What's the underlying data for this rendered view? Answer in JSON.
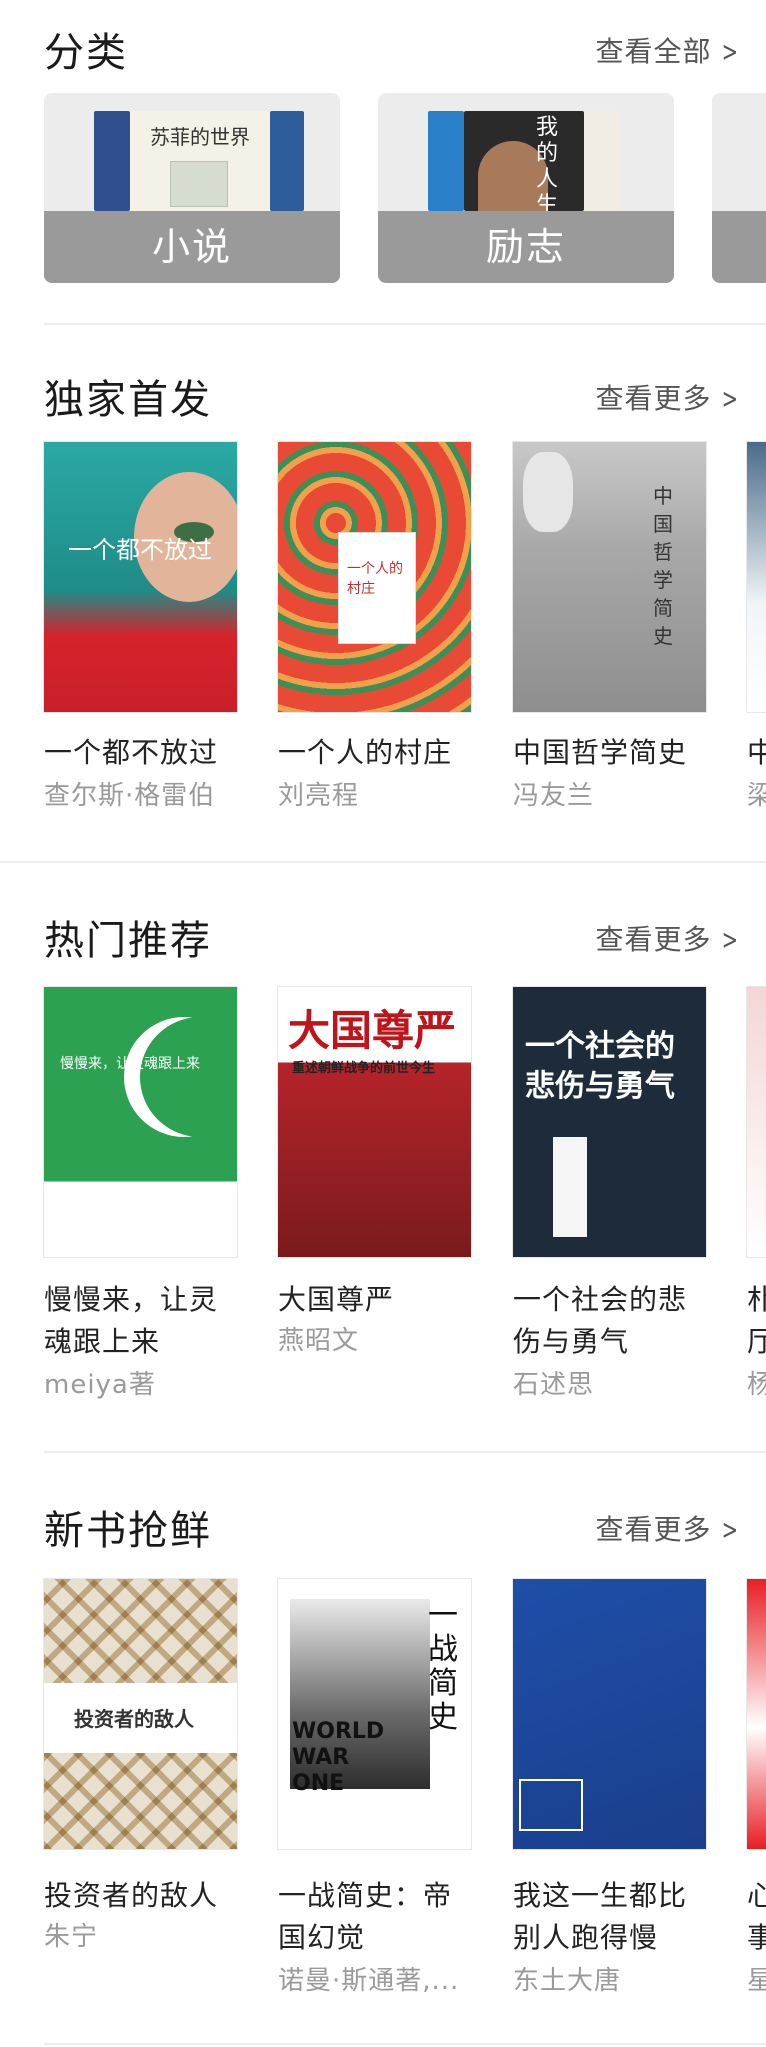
{
  "categories": {
    "title": "分类",
    "more": "查看全部",
    "items": [
      {
        "label": "小说",
        "cover_text": "苏菲的世界"
      },
      {
        "label": "励志",
        "cover_text": "我的人生"
      }
    ]
  },
  "exclusive": {
    "title": "独家首发",
    "more": "查看更多",
    "books": [
      {
        "title": "一个都不放过",
        "author": "查尔斯·格雷伯",
        "cover_text": "一个都不放过"
      },
      {
        "title": "一个人的村庄",
        "author": "刘亮程",
        "cover_text": "一个人的村庄"
      },
      {
        "title": "中国哲学简史",
        "author": "冯友兰",
        "cover_text": "中国哲学简史"
      },
      {
        "title": "中",
        "author": "梁",
        "cover_text": ""
      }
    ]
  },
  "hot": {
    "title": "热门推荐",
    "more": "查看更多",
    "books": [
      {
        "title_line1": "慢慢来，让灵",
        "title_line2": "魂跟上来",
        "author": "meiya著",
        "cover_text": "慢慢来，让灵魂跟上来"
      },
      {
        "title_line1": "大国尊严",
        "title_line2": "",
        "author": "燕昭文",
        "cover_text": "大国尊严",
        "cover_sub": "重述朝鲜战争的前世今生"
      },
      {
        "title_line1": "一个社会的悲",
        "title_line2": "伤与勇气",
        "author": "石述思",
        "cover_text": "一个社会的悲伤与勇气"
      },
      {
        "title_line1": "朴",
        "title_line2": "厅",
        "author": "杨",
        "cover_text": ""
      }
    ]
  },
  "new_books": {
    "title": "新书抢鲜",
    "more": "查看更多",
    "books": [
      {
        "title_line1": "投资者的敌人",
        "title_line2": "",
        "author": "朱宁",
        "cover_text": "投资者的敌人"
      },
      {
        "title_line1": "一战简史：帝",
        "title_line2": "国幻觉",
        "author": "诺曼·斯通著,...",
        "cover_text": "一战简史",
        "cover_en": "WORLD WAR ONE"
      },
      {
        "title_line1": "我这一生都比",
        "title_line2": "别人跑得慢",
        "author": "东土大唐",
        "cover_text": ""
      },
      {
        "title_line1": "心",
        "title_line2": "事",
        "author": "星",
        "cover_text": ""
      }
    ]
  },
  "colors": {
    "header_text": "#1a1a1a",
    "secondary_text": "#9a9a9a",
    "card_bg": "#ececec",
    "label_band": "#9a9a9a"
  }
}
